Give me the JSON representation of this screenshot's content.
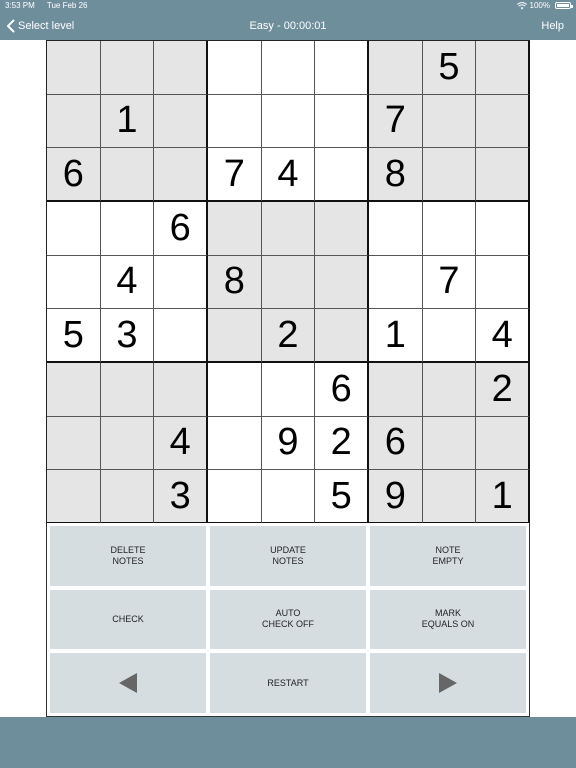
{
  "status_bar": {
    "time": "3:53 PM",
    "date": "Tue Feb 26",
    "battery": "100%"
  },
  "nav": {
    "back_label": "Select level",
    "title": "Easy - 00:00:01",
    "help_label": "Help"
  },
  "colors": {
    "bar": "#6f8e9c",
    "shaded_cell": "#e5e5e5",
    "button": "#d6dde1"
  },
  "grid": {
    "rows": [
      [
        "",
        "",
        "",
        "",
        "",
        "",
        "",
        "5",
        ""
      ],
      [
        "",
        "1",
        "",
        "",
        "",
        "",
        "7",
        "",
        ""
      ],
      [
        "6",
        "",
        "",
        "7",
        "4",
        "",
        "8",
        "",
        ""
      ],
      [
        "",
        "",
        "6",
        "",
        "",
        "",
        "",
        "",
        ""
      ],
      [
        "",
        "4",
        "",
        "8",
        "",
        "",
        "",
        "7",
        ""
      ],
      [
        "5",
        "3",
        "",
        "",
        "2",
        "",
        "1",
        "",
        "4"
      ],
      [
        "",
        "",
        "",
        "",
        "",
        "6",
        "",
        "",
        "2"
      ],
      [
        "",
        "",
        "4",
        "",
        "9",
        "2",
        "6",
        "",
        ""
      ],
      [
        "",
        "",
        "3",
        "",
        "",
        "5",
        "9",
        "",
        "1"
      ]
    ]
  },
  "buttons": {
    "delete_notes": [
      "DELETE",
      "NOTES"
    ],
    "update_notes": [
      "UPDATE",
      "NOTES"
    ],
    "note_empty": [
      "NOTE",
      "EMPTY"
    ],
    "check": "CHECK",
    "auto_check": [
      "AUTO",
      "CHECK OFF"
    ],
    "mark_equals": [
      "MARK",
      "EQUALS ON"
    ],
    "prev_icon": "left-triangle",
    "restart": "RESTART",
    "next_icon": "right-triangle"
  }
}
